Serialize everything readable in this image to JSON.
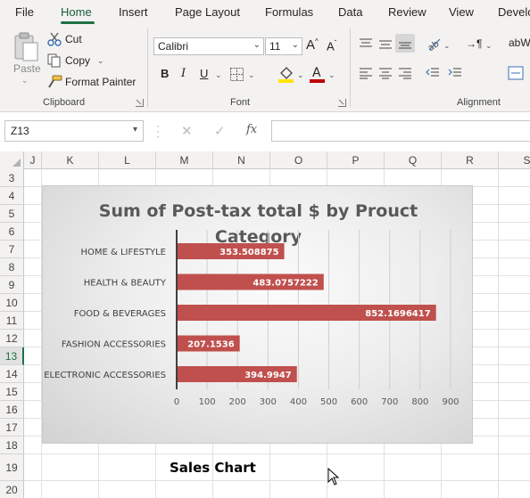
{
  "menu": {
    "tabs": [
      "File",
      "Home",
      "Insert",
      "Page Layout",
      "Formulas",
      "Data",
      "Review",
      "View",
      "Develo"
    ],
    "active_tab": "Home"
  },
  "ribbon": {
    "clipboard": {
      "paste": "Paste",
      "cut": "Cut",
      "copy": "Copy",
      "format_painter": "Format Painter",
      "label": "Clipboard"
    },
    "font": {
      "font_name": "Calibri",
      "font_size": "11",
      "bold": "B",
      "italic": "I",
      "underline": "U",
      "grow": "A",
      "shrink": "A",
      "label": "Font"
    },
    "alignment": {
      "wrap": "ab",
      "wrap_suffix": "W",
      "label": "Alignment"
    }
  },
  "formula_bar": {
    "name_box": "Z13",
    "fx": "fx",
    "cancel": "✕",
    "enter": "✓",
    "value": ""
  },
  "grid": {
    "columns": [
      "J",
      "K",
      "L",
      "M",
      "N",
      "O",
      "P",
      "Q",
      "R",
      "S"
    ],
    "rows": [
      "3",
      "4",
      "5",
      "6",
      "7",
      "8",
      "9",
      "10",
      "11",
      "12",
      "13",
      "14",
      "15",
      "16",
      "17",
      "18",
      "19",
      "20"
    ],
    "active_row": "13",
    "sheet_label": "Sales Chart"
  },
  "chart_data": {
    "type": "bar",
    "orientation": "horizontal",
    "title": "Sum of Post-tax total $ by Prouct Category",
    "title_lines": [
      "Sum of Post-tax total $ by Prouct",
      "Category"
    ],
    "categories": [
      "HOME & LIFESTYLE",
      "HEALTH & BEAUTY",
      "FOOD & BEVERAGES",
      "FASHION ACCESSORIES",
      "ELECTRONIC ACCESSORIES"
    ],
    "values": [
      353.508875,
      483.0757222,
      852.1696417,
      207.1536,
      394.9947
    ],
    "data_labels": [
      "353.508875",
      "483.0757222",
      "852.1696417",
      "207.1536",
      "394.9947"
    ],
    "xlim": [
      0,
      900
    ],
    "xticks": [
      0,
      100,
      200,
      300,
      400,
      500,
      600,
      700,
      800,
      900
    ],
    "grid": true,
    "bar_color": "#c0504d"
  },
  "colors": {
    "accent": "#1e7145",
    "ribbon_bg": "#f3f2f1",
    "bar": "#c0504d"
  }
}
